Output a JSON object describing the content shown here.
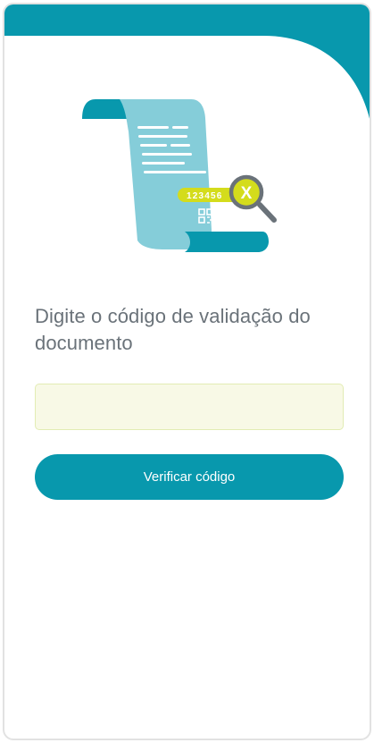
{
  "title": "Digite o código de validação do documento",
  "code_input": {
    "value": "",
    "placeholder": ""
  },
  "verify_button_label": "Verificar código",
  "illustration": {
    "code_number": "123456",
    "badge_letter": "X"
  },
  "colors": {
    "primary": "#0898ad",
    "paper": "#85cdd9",
    "accent_yellow": "#d4dc1c",
    "input_background": "#f8f9e6",
    "text": "#6a7279"
  }
}
